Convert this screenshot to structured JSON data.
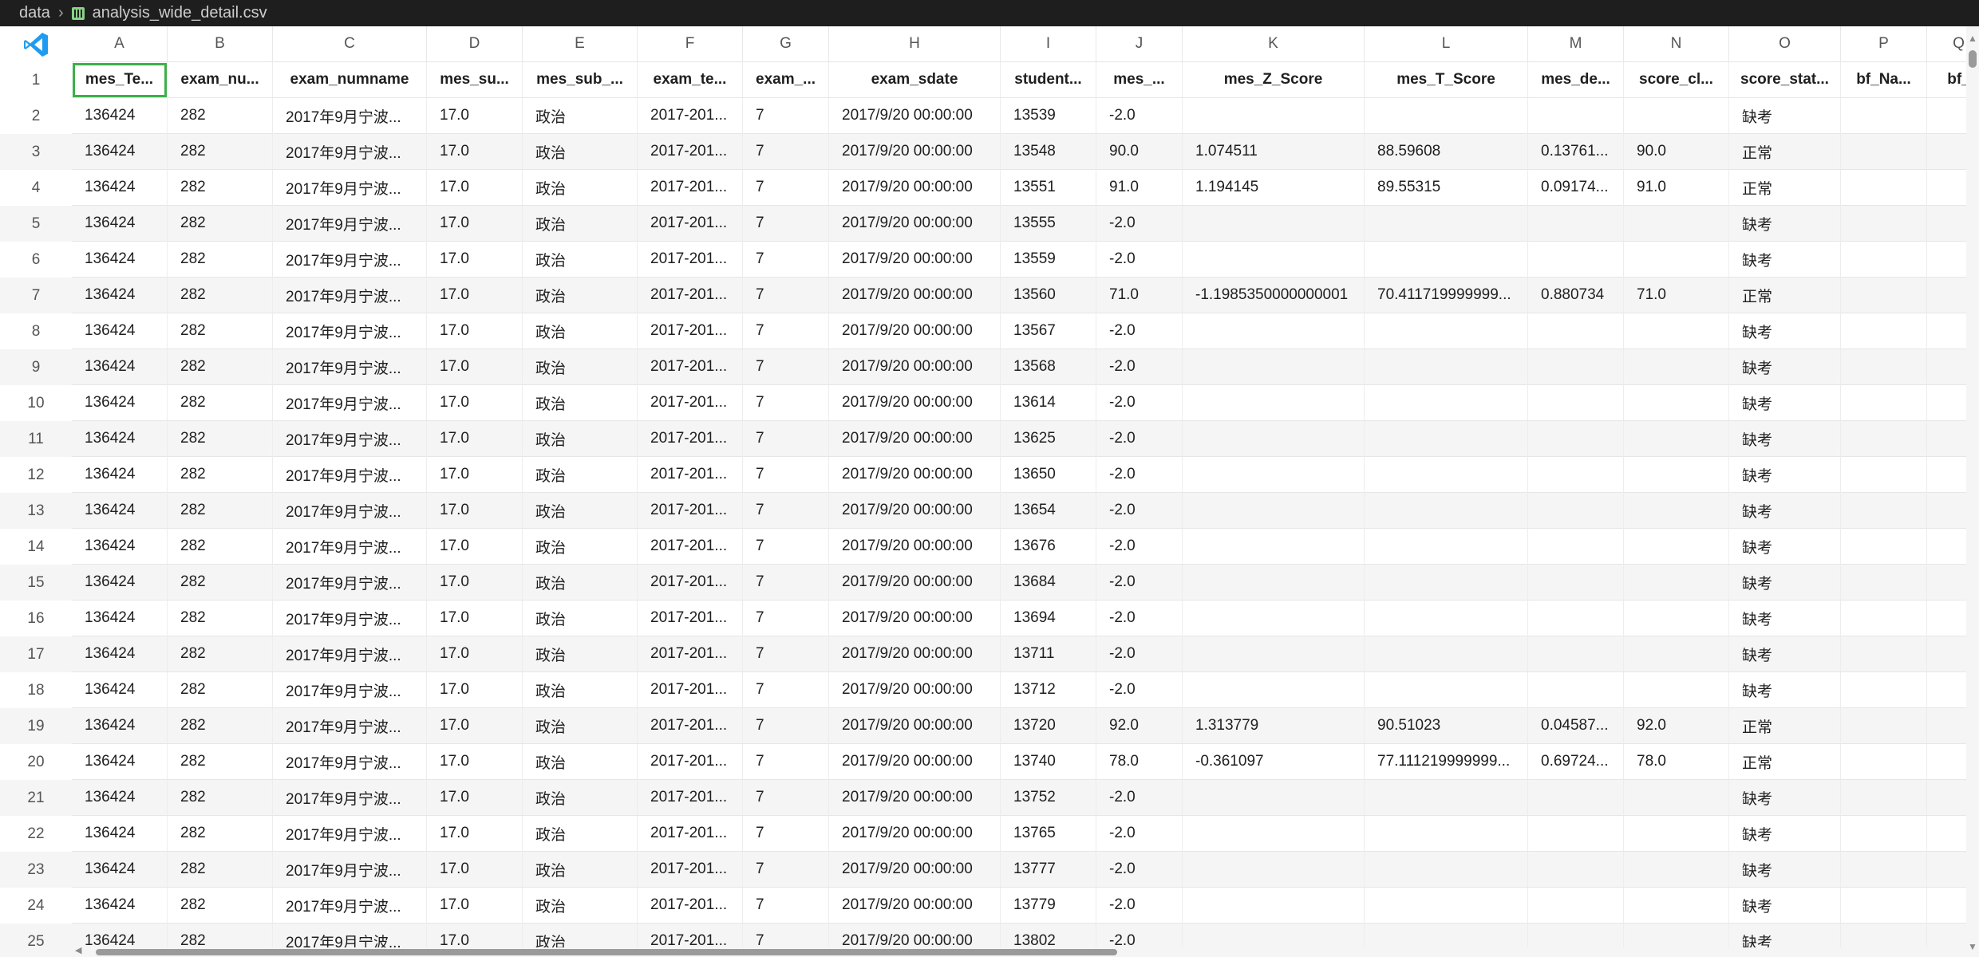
{
  "breadcrumb": {
    "folder": "data",
    "file": "analysis_wide_detail.csv"
  },
  "logo": {
    "icon": "vscode-logo-icon",
    "color": "#1f9cf0"
  },
  "colors": {
    "selection": "#3cb04a",
    "scrollbar": "#9a9a9a"
  },
  "column_letters": [
    "A",
    "B",
    "C",
    "D",
    "E",
    "F",
    "G",
    "H",
    "I",
    "J",
    "K",
    "L",
    "M",
    "N",
    "O",
    "P",
    "Q"
  ],
  "header_row": [
    "mes_Te...",
    "exam_nu...",
    "exam_numname",
    "mes_su...",
    "mes_sub_...",
    "exam_te...",
    "exam_...",
    "exam_sdate",
    "student...",
    "mes_...",
    "mes_Z_Score",
    "mes_T_Score",
    "mes_de...",
    "score_cl...",
    "score_stat...",
    "bf_Na...",
    "bf_"
  ],
  "rows": [
    [
      "136424",
      "282",
      "2017年9月宁波...",
      "17.0",
      "政治",
      "2017-201...",
      "7",
      "2017/9/20 00:00:00",
      "13539",
      "-2.0",
      "",
      "",
      "",
      "",
      "缺考",
      "",
      ""
    ],
    [
      "136424",
      "282",
      "2017年9月宁波...",
      "17.0",
      "政治",
      "2017-201...",
      "7",
      "2017/9/20 00:00:00",
      "13548",
      "90.0",
      "1.074511",
      "88.59608",
      "0.13761...",
      "90.0",
      "正常",
      "",
      ""
    ],
    [
      "136424",
      "282",
      "2017年9月宁波...",
      "17.0",
      "政治",
      "2017-201...",
      "7",
      "2017/9/20 00:00:00",
      "13551",
      "91.0",
      "1.194145",
      "89.55315",
      "0.09174...",
      "91.0",
      "正常",
      "",
      ""
    ],
    [
      "136424",
      "282",
      "2017年9月宁波...",
      "17.0",
      "政治",
      "2017-201...",
      "7",
      "2017/9/20 00:00:00",
      "13555",
      "-2.0",
      "",
      "",
      "",
      "",
      "缺考",
      "",
      ""
    ],
    [
      "136424",
      "282",
      "2017年9月宁波...",
      "17.0",
      "政治",
      "2017-201...",
      "7",
      "2017/9/20 00:00:00",
      "13559",
      "-2.0",
      "",
      "",
      "",
      "",
      "缺考",
      "",
      ""
    ],
    [
      "136424",
      "282",
      "2017年9月宁波...",
      "17.0",
      "政治",
      "2017-201...",
      "7",
      "2017/9/20 00:00:00",
      "13560",
      "71.0",
      "-1.1985350000000001",
      "70.411719999999...",
      "0.880734",
      "71.0",
      "正常",
      "",
      ""
    ],
    [
      "136424",
      "282",
      "2017年9月宁波...",
      "17.0",
      "政治",
      "2017-201...",
      "7",
      "2017/9/20 00:00:00",
      "13567",
      "-2.0",
      "",
      "",
      "",
      "",
      "缺考",
      "",
      ""
    ],
    [
      "136424",
      "282",
      "2017年9月宁波...",
      "17.0",
      "政治",
      "2017-201...",
      "7",
      "2017/9/20 00:00:00",
      "13568",
      "-2.0",
      "",
      "",
      "",
      "",
      "缺考",
      "",
      ""
    ],
    [
      "136424",
      "282",
      "2017年9月宁波...",
      "17.0",
      "政治",
      "2017-201...",
      "7",
      "2017/9/20 00:00:00",
      "13614",
      "-2.0",
      "",
      "",
      "",
      "",
      "缺考",
      "",
      ""
    ],
    [
      "136424",
      "282",
      "2017年9月宁波...",
      "17.0",
      "政治",
      "2017-201...",
      "7",
      "2017/9/20 00:00:00",
      "13625",
      "-2.0",
      "",
      "",
      "",
      "",
      "缺考",
      "",
      ""
    ],
    [
      "136424",
      "282",
      "2017年9月宁波...",
      "17.0",
      "政治",
      "2017-201...",
      "7",
      "2017/9/20 00:00:00",
      "13650",
      "-2.0",
      "",
      "",
      "",
      "",
      "缺考",
      "",
      ""
    ],
    [
      "136424",
      "282",
      "2017年9月宁波...",
      "17.0",
      "政治",
      "2017-201...",
      "7",
      "2017/9/20 00:00:00",
      "13654",
      "-2.0",
      "",
      "",
      "",
      "",
      "缺考",
      "",
      ""
    ],
    [
      "136424",
      "282",
      "2017年9月宁波...",
      "17.0",
      "政治",
      "2017-201...",
      "7",
      "2017/9/20 00:00:00",
      "13676",
      "-2.0",
      "",
      "",
      "",
      "",
      "缺考",
      "",
      ""
    ],
    [
      "136424",
      "282",
      "2017年9月宁波...",
      "17.0",
      "政治",
      "2017-201...",
      "7",
      "2017/9/20 00:00:00",
      "13684",
      "-2.0",
      "",
      "",
      "",
      "",
      "缺考",
      "",
      ""
    ],
    [
      "136424",
      "282",
      "2017年9月宁波...",
      "17.0",
      "政治",
      "2017-201...",
      "7",
      "2017/9/20 00:00:00",
      "13694",
      "-2.0",
      "",
      "",
      "",
      "",
      "缺考",
      "",
      ""
    ],
    [
      "136424",
      "282",
      "2017年9月宁波...",
      "17.0",
      "政治",
      "2017-201...",
      "7",
      "2017/9/20 00:00:00",
      "13711",
      "-2.0",
      "",
      "",
      "",
      "",
      "缺考",
      "",
      ""
    ],
    [
      "136424",
      "282",
      "2017年9月宁波...",
      "17.0",
      "政治",
      "2017-201...",
      "7",
      "2017/9/20 00:00:00",
      "13712",
      "-2.0",
      "",
      "",
      "",
      "",
      "缺考",
      "",
      ""
    ],
    [
      "136424",
      "282",
      "2017年9月宁波...",
      "17.0",
      "政治",
      "2017-201...",
      "7",
      "2017/9/20 00:00:00",
      "13720",
      "92.0",
      "1.313779",
      "90.51023",
      "0.04587...",
      "92.0",
      "正常",
      "",
      ""
    ],
    [
      "136424",
      "282",
      "2017年9月宁波...",
      "17.0",
      "政治",
      "2017-201...",
      "7",
      "2017/9/20 00:00:00",
      "13740",
      "78.0",
      "-0.361097",
      "77.111219999999...",
      "0.69724...",
      "78.0",
      "正常",
      "",
      ""
    ],
    [
      "136424",
      "282",
      "2017年9月宁波...",
      "17.0",
      "政治",
      "2017-201...",
      "7",
      "2017/9/20 00:00:00",
      "13752",
      "-2.0",
      "",
      "",
      "",
      "",
      "缺考",
      "",
      ""
    ],
    [
      "136424",
      "282",
      "2017年9月宁波...",
      "17.0",
      "政治",
      "2017-201...",
      "7",
      "2017/9/20 00:00:00",
      "13765",
      "-2.0",
      "",
      "",
      "",
      "",
      "缺考",
      "",
      ""
    ],
    [
      "136424",
      "282",
      "2017年9月宁波...",
      "17.0",
      "政治",
      "2017-201...",
      "7",
      "2017/9/20 00:00:00",
      "13777",
      "-2.0",
      "",
      "",
      "",
      "",
      "缺考",
      "",
      ""
    ],
    [
      "136424",
      "282",
      "2017年9月宁波...",
      "17.0",
      "政治",
      "2017-201...",
      "7",
      "2017/9/20 00:00:00",
      "13779",
      "-2.0",
      "",
      "",
      "",
      "",
      "缺考",
      "",
      ""
    ],
    [
      "136424",
      "282",
      "2017年9月宁波...",
      "17.0",
      "政治",
      "2017-201...",
      "7",
      "2017/9/20 00:00:00",
      "13802",
      "-2.0",
      "",
      "",
      "",
      "",
      "缺考",
      "",
      ""
    ]
  ]
}
